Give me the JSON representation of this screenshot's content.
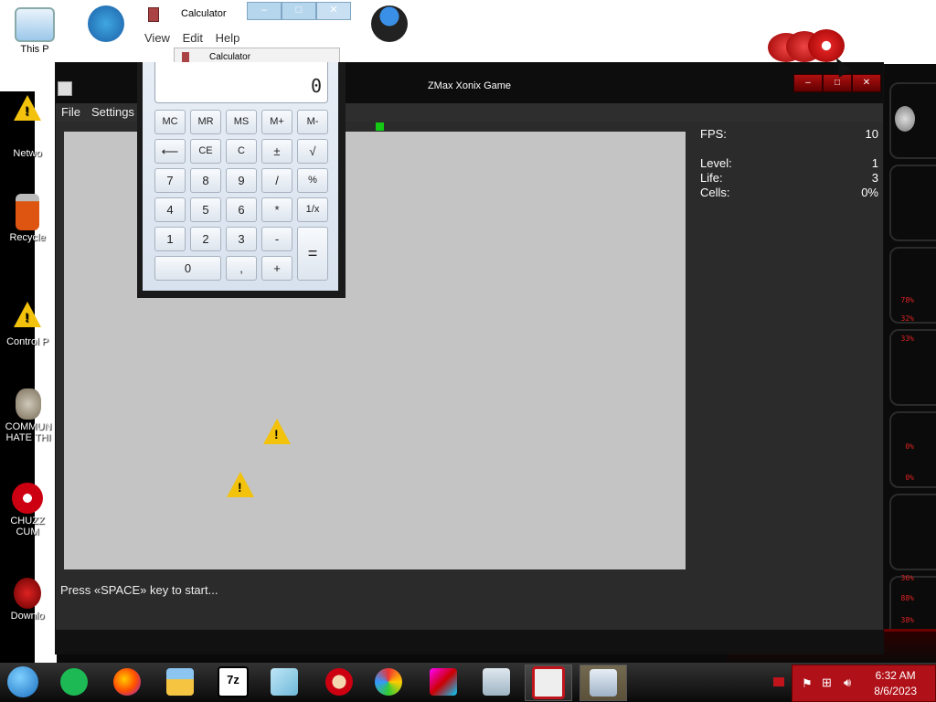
{
  "desktop": {
    "icons": [
      {
        "label": "This P",
        "icon": "monitor-icon"
      },
      {
        "label": "Netwo",
        "icon": "warning-icon"
      },
      {
        "label": "Recycle",
        "icon": "recycle-bin-icon"
      },
      {
        "label": "Control P",
        "icon": "warning-icon"
      },
      {
        "label": "COMMUN HATE THI",
        "icon": "money-bag-icon"
      },
      {
        "label": "CHUZZ CUM",
        "icon": "chuzzle-icon"
      },
      {
        "label": "Downlo",
        "icon": "download-icon"
      }
    ]
  },
  "calc_behind": {
    "title": "Calculator",
    "menu": [
      "View",
      "Edit",
      "Help"
    ],
    "title2": "Calculator"
  },
  "calc": {
    "display": "0",
    "keys": {
      "mc": "MC",
      "mr": "MR",
      "ms": "MS",
      "mplus": "M+",
      "mminus": "M-",
      "back": "⟵",
      "ce": "CE",
      "c": "C",
      "pm": "±",
      "sqrt": "√",
      "k7": "7",
      "k8": "8",
      "k9": "9",
      "div": "/",
      "pct": "%",
      "k4": "4",
      "k5": "5",
      "k6": "6",
      "mul": "*",
      "inv": "1/x",
      "k1": "1",
      "k2": "2",
      "k3": "3",
      "sub": "-",
      "eq": "=",
      "k0": "0",
      "dot": ",",
      "add": "+"
    }
  },
  "game": {
    "title": "ZMax Xonix Game",
    "menu": [
      "File",
      "Settings"
    ],
    "stats": {
      "fps_label": "FPS:",
      "fps": "10",
      "level_label": "Level:",
      "level": "1",
      "life_label": "Life:",
      "life": "3",
      "cells_label": "Cells:",
      "cells": "0%"
    },
    "status": "Press «SPACE» key to start..."
  },
  "alien_panel": {
    "percents": [
      "78%",
      "32%",
      "33%",
      "0%",
      "0%",
      "36%",
      "88%",
      "38%"
    ]
  },
  "taskbar": {
    "items": [
      "spotify-icon",
      "firefox-icon",
      "file-explorer-icon",
      "7zip-icon",
      "notepad-icon",
      "game-icon",
      "paint-icon",
      "monitor-app-icon",
      "task-manager-icon",
      "xonix-icon",
      "calculator-icon"
    ],
    "time": "6:32 AM",
    "date": "8/6/2023"
  },
  "colors": {
    "accent": "#b01018",
    "field": "#c4c4c4",
    "marker": "#13c913"
  }
}
